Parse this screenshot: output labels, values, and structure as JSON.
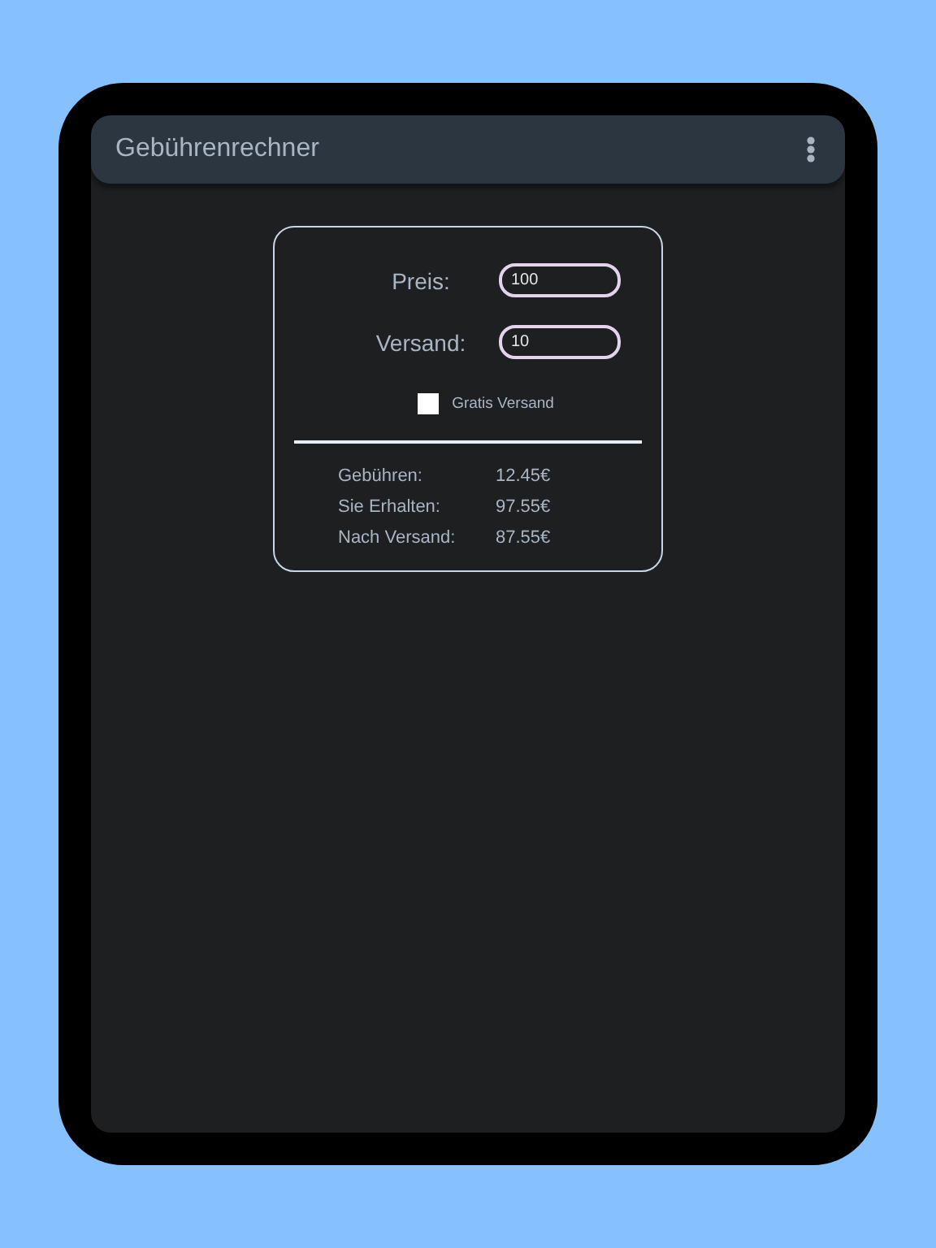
{
  "app_bar": {
    "title": "Gebührenrechner"
  },
  "form": {
    "fields": [
      {
        "label": "Preis:",
        "value": "100"
      },
      {
        "label": "Versand:",
        "value": "10"
      }
    ],
    "free_shipping": {
      "label": "Gratis Versand",
      "checked": false
    }
  },
  "results": [
    {
      "label": "Gebühren:",
      "value": "12.45€"
    },
    {
      "label": "Sie Erhalten:",
      "value": "97.55€"
    },
    {
      "label": "Nach Versand:",
      "value": "87.55€"
    }
  ]
}
